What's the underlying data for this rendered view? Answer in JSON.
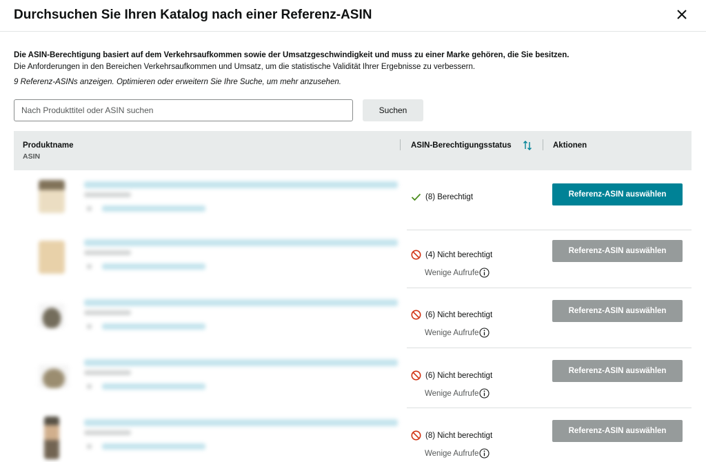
{
  "header": {
    "title": "Durchsuchen Sie Ihren Katalog nach einer Referenz-ASIN"
  },
  "description": {
    "line1": "Die ASIN-Berechtigung basiert auf dem Verkehrsaufkommen sowie der Umsatzgeschwindigkeit und muss zu einer Marke gehören, die Sie besitzen.",
    "line2": "Die Anforderungen in den Bereichen Verkehrsaufkommen und Umsatz, um die statistische Validität Ihrer Ergebnisse zu verbessern."
  },
  "result_count": "9 Referenz-ASINs anzeigen. Optimieren oder erweitern Sie Ihre Suche, um mehr anzusehen.",
  "search": {
    "placeholder": "Nach Produkttitel oder ASIN suchen",
    "button_label": "Suchen"
  },
  "table": {
    "col_product": "Produktname",
    "col_product_sub": "ASIN",
    "col_status": "ASIN-Berechtigungsstatus",
    "col_actions": "Aktionen",
    "rows": [
      {
        "status": "(8) Berechtigt",
        "eligible": true,
        "reason": "",
        "action": "Referenz-ASIN auswählen"
      },
      {
        "status": "(4) Nicht berechtigt",
        "eligible": false,
        "reason": "Wenige Aufrufe",
        "action": "Referenz-ASIN auswählen"
      },
      {
        "status": "(6) Nicht berechtigt",
        "eligible": false,
        "reason": "Wenige Aufrufe",
        "action": "Referenz-ASIN auswählen"
      },
      {
        "status": "(6) Nicht berechtigt",
        "eligible": false,
        "reason": "Wenige Aufrufe",
        "action": "Referenz-ASIN auswählen"
      },
      {
        "status": "(8) Nicht berechtigt",
        "eligible": false,
        "reason": "Wenige Aufrufe",
        "action": "Referenz-ASIN auswählen"
      }
    ]
  },
  "colors": {
    "accent": "#008296",
    "disabled": "#969b9b",
    "eligible": "#4a8c1c",
    "ineligible": "#d13212"
  },
  "icons": {
    "close": "close-icon",
    "sort": "sort-icon",
    "check": "check-icon",
    "not_allowed": "not-allowed-icon",
    "info": "info-icon"
  }
}
